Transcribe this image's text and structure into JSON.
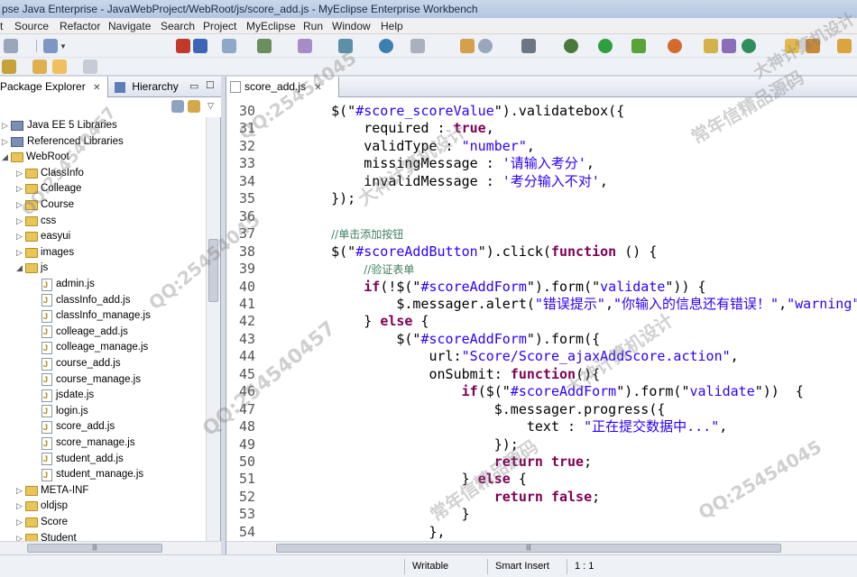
{
  "window": {
    "title": "pse Java Enterprise - JavaWebProject/WebRoot/js/score_add.js - MyEclipse Enterprise Workbench"
  },
  "menu": [
    "t",
    "Source",
    "Refactor",
    "Navigate",
    "Search",
    "Project",
    "MyEclipse",
    "Run",
    "Window",
    "Help"
  ],
  "explorer": {
    "tab_label": "Package Explorer",
    "tab2_label": "Hierarchy",
    "items": [
      {
        "label": "Java EE 5 Libraries",
        "kind": "lib",
        "indent": 1
      },
      {
        "label": "Referenced Libraries",
        "kind": "lib",
        "indent": 1
      },
      {
        "label": "WebRoot",
        "kind": "folder",
        "indent": 1
      },
      {
        "label": "ClassInfo",
        "kind": "folder",
        "indent": 2
      },
      {
        "label": "Colleage",
        "kind": "folder",
        "indent": 2
      },
      {
        "label": "Course",
        "kind": "folder",
        "indent": 2
      },
      {
        "label": "css",
        "kind": "folder",
        "indent": 2
      },
      {
        "label": "easyui",
        "kind": "folder",
        "indent": 2
      },
      {
        "label": "images",
        "kind": "folder",
        "indent": 2
      },
      {
        "label": "js",
        "kind": "folder",
        "indent": 2
      },
      {
        "label": "admin.js",
        "kind": "js",
        "indent": 3
      },
      {
        "label": "classInfo_add.js",
        "kind": "js",
        "indent": 3
      },
      {
        "label": "classInfo_manage.js",
        "kind": "js",
        "indent": 3
      },
      {
        "label": "colleage_add.js",
        "kind": "js",
        "indent": 3
      },
      {
        "label": "colleage_manage.js",
        "kind": "js",
        "indent": 3
      },
      {
        "label": "course_add.js",
        "kind": "js",
        "indent": 3
      },
      {
        "label": "course_manage.js",
        "kind": "js",
        "indent": 3
      },
      {
        "label": "jsdate.js",
        "kind": "js",
        "indent": 3
      },
      {
        "label": "login.js",
        "kind": "js",
        "indent": 3
      },
      {
        "label": "score_add.js",
        "kind": "js",
        "indent": 3
      },
      {
        "label": "score_manage.js",
        "kind": "js",
        "indent": 3
      },
      {
        "label": "student_add.js",
        "kind": "js",
        "indent": 3
      },
      {
        "label": "student_manage.js",
        "kind": "js",
        "indent": 3
      },
      {
        "label": "META-INF",
        "kind": "folder",
        "indent": 2
      },
      {
        "label": "oldjsp",
        "kind": "folder",
        "indent": 2
      },
      {
        "label": "Score",
        "kind": "folder",
        "indent": 2
      },
      {
        "label": "Student",
        "kind": "folder",
        "indent": 2
      }
    ]
  },
  "editor": {
    "tab_label": "score_add.js",
    "lines": [
      {
        "n": "30",
        "parts": [
          [
            "p",
            "    $(\""
          ],
          [
            "s",
            "#score_scoreValue"
          ],
          [
            "p",
            "\").validatebox({"
          ]
        ]
      },
      {
        "n": "31",
        "parts": [
          [
            "p",
            "        required : "
          ],
          [
            "k",
            "true"
          ],
          [
            "p",
            ","
          ]
        ]
      },
      {
        "n": "32",
        "parts": [
          [
            "p",
            "        validType : "
          ],
          [
            "s",
            "\"number\""
          ],
          [
            "p",
            ","
          ]
        ]
      },
      {
        "n": "33",
        "parts": [
          [
            "p",
            "        missingMessage : "
          ],
          [
            "s",
            "'请输入考分'"
          ],
          [
            "p",
            ","
          ]
        ]
      },
      {
        "n": "34",
        "parts": [
          [
            "p",
            "        invalidMessage : "
          ],
          [
            "s",
            "'考分输入不对'"
          ],
          [
            "p",
            ","
          ]
        ]
      },
      {
        "n": "35",
        "parts": [
          [
            "p",
            "    });"
          ]
        ]
      },
      {
        "n": "36",
        "parts": [
          [
            "p",
            ""
          ]
        ]
      },
      {
        "n": "37",
        "parts": [
          [
            "p",
            "    "
          ],
          [
            "c",
            "//单击添加按钮"
          ]
        ]
      },
      {
        "n": "38",
        "parts": [
          [
            "p",
            "    $(\""
          ],
          [
            "s",
            "#scoreAddButton"
          ],
          [
            "p",
            "\").click("
          ],
          [
            "k",
            "function"
          ],
          [
            "p",
            " () {"
          ]
        ]
      },
      {
        "n": "39",
        "parts": [
          [
            "p",
            "        "
          ],
          [
            "c",
            "//验证表单"
          ]
        ]
      },
      {
        "n": "40",
        "parts": [
          [
            "p",
            "        "
          ],
          [
            "k",
            "if"
          ],
          [
            "p",
            "(!$(\""
          ],
          [
            "s",
            "#scoreAddForm"
          ],
          [
            "p",
            "\").form(\""
          ],
          [
            "s",
            "validate"
          ],
          [
            "p",
            "\")) {"
          ]
        ]
      },
      {
        "n": "41",
        "parts": [
          [
            "p",
            "            $.messager.alert("
          ],
          [
            "s",
            "\"错误提示\""
          ],
          [
            "p",
            ","
          ],
          [
            "s",
            "\"你输入的信息还有错误！\""
          ],
          [
            "p",
            ","
          ],
          [
            "s",
            "\"warning\""
          ],
          [
            "p",
            ");"
          ]
        ]
      },
      {
        "n": "42",
        "parts": [
          [
            "p",
            "        } "
          ],
          [
            "k",
            "else"
          ],
          [
            "p",
            " {"
          ]
        ]
      },
      {
        "n": "43",
        "parts": [
          [
            "p",
            "            $(\""
          ],
          [
            "s",
            "#scoreAddForm"
          ],
          [
            "p",
            "\").form({"
          ]
        ]
      },
      {
        "n": "44",
        "parts": [
          [
            "p",
            "                url:"
          ],
          [
            "s",
            "\"Score/Score_ajaxAddScore.action\""
          ],
          [
            "p",
            ","
          ]
        ]
      },
      {
        "n": "45",
        "parts": [
          [
            "p",
            "                onSubmit: "
          ],
          [
            "k",
            "function"
          ],
          [
            "p",
            "(){"
          ]
        ]
      },
      {
        "n": "46",
        "parts": [
          [
            "p",
            "                    "
          ],
          [
            "k",
            "if"
          ],
          [
            "p",
            "($(\""
          ],
          [
            "s",
            "#scoreAddForm"
          ],
          [
            "p",
            "\").form(\""
          ],
          [
            "s",
            "validate"
          ],
          [
            "p",
            "\"))  {"
          ]
        ]
      },
      {
        "n": "47",
        "parts": [
          [
            "p",
            "                        $.messager.progress({"
          ]
        ]
      },
      {
        "n": "48",
        "parts": [
          [
            "p",
            "                            text : "
          ],
          [
            "s",
            "\"正在提交数据中...\""
          ],
          [
            "p",
            ","
          ]
        ]
      },
      {
        "n": "49",
        "parts": [
          [
            "p",
            "                        });"
          ]
        ]
      },
      {
        "n": "50",
        "parts": [
          [
            "p",
            "                        "
          ],
          [
            "k",
            "return true"
          ],
          [
            "p",
            ";"
          ]
        ]
      },
      {
        "n": "51",
        "parts": [
          [
            "p",
            "                    } "
          ],
          [
            "k",
            "else"
          ],
          [
            "p",
            " {"
          ]
        ]
      },
      {
        "n": "52",
        "parts": [
          [
            "p",
            "                        "
          ],
          [
            "k",
            "return false"
          ],
          [
            "p",
            ";"
          ]
        ]
      },
      {
        "n": "53",
        "parts": [
          [
            "p",
            "                    }"
          ]
        ]
      },
      {
        "n": "54",
        "parts": [
          [
            "p",
            "                },"
          ]
        ]
      }
    ]
  },
  "status": {
    "writable": "Writable",
    "insert_mode": "Smart Insert",
    "position": "1 : 1"
  },
  "watermarks": [
    "QQ:25454045",
    "大神计算机设计",
    "常年信精品源码",
    "QQ:25454045",
    "大神计算机设计",
    "QQ:254540457",
    "常年信精品源码",
    "QQ:25454045",
    "大神计算机设计",
    "QQ:254540457"
  ],
  "colors": {
    "keyword": "#7f0055",
    "string": "#2a00ff",
    "comment": "#3f7f5f"
  }
}
